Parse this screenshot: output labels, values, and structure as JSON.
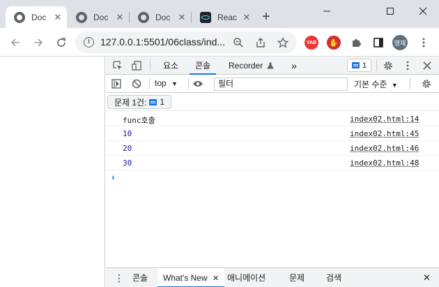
{
  "browser": {
    "tabs": [
      {
        "title": "Doc",
        "icon": "globe-icon",
        "active": true
      },
      {
        "title": "Doc",
        "icon": "globe-icon",
        "active": false
      },
      {
        "title": "Doc",
        "icon": "globe-icon",
        "active": false
      },
      {
        "title": "Reac",
        "icon": "react-icon",
        "active": false
      }
    ],
    "new_tab": "+",
    "window_controls": {
      "minimize": "—",
      "maximize": "☐",
      "close": "✕"
    },
    "url": "127.0.0.1:5501/06class/ind...",
    "extensions": [
      {
        "name": "yab-extension-icon",
        "label": "YAB",
        "color": "#e53935"
      },
      {
        "name": "adblock-extension-icon",
        "label": "✋",
        "color": "#d32f2f"
      }
    ],
    "profile_initials": "영재"
  },
  "devtools": {
    "tabs": {
      "elements": "요소",
      "console": "콘솔",
      "recorder": "Recorder",
      "more": "»"
    },
    "issues_count": "1",
    "context": "top",
    "filter_placeholder": "필터",
    "level": "기본 수준",
    "issues_button": "문제 1건:",
    "issues_button_count": "1",
    "accent": "#1a73e8"
  },
  "console": {
    "rows": [
      {
        "message": "func호출",
        "source": "index02.html:14",
        "numeric": false
      },
      {
        "message": "10",
        "source": "index02.html:45",
        "numeric": true
      },
      {
        "message": "20",
        "source": "index02.html:46",
        "numeric": true
      },
      {
        "message": "30",
        "source": "index02.html:48",
        "numeric": true
      }
    ],
    "prompt": "›"
  },
  "drawer": {
    "menu": "⋮",
    "tabs": [
      "콘솔",
      "What's New",
      "애니메이션",
      "문제",
      "검색"
    ],
    "active_close": "✕",
    "close": "✕"
  }
}
